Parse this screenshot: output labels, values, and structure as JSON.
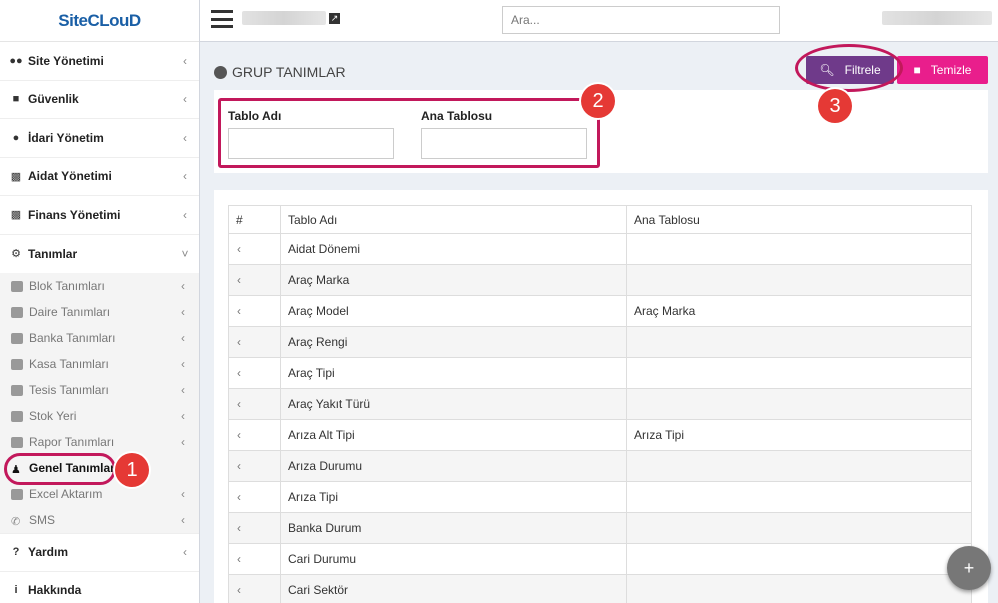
{
  "app": {
    "logo": "SiteCLouD"
  },
  "topbar": {
    "search_placeholder": "Ara..."
  },
  "sidebar": {
    "top_items": [
      {
        "label": "Site Yönetimi",
        "icon": "users-icon"
      },
      {
        "label": "Güvenlik",
        "icon": "lock-icon"
      },
      {
        "label": "İdari Yönetim",
        "icon": "globe-icon"
      },
      {
        "label": "Aidat Yönetimi",
        "icon": "money-icon"
      },
      {
        "label": "Finans Yönetimi",
        "icon": "money-icon"
      },
      {
        "label": "Tanımlar",
        "icon": "gear-icon"
      }
    ],
    "sub_items": [
      {
        "label": "Blok Tanımları",
        "icon": "building-icon"
      },
      {
        "label": "Daire Tanımları",
        "icon": "door-icon"
      },
      {
        "label": "Banka Tanımları",
        "icon": "card-icon"
      },
      {
        "label": "Kasa Tanımları",
        "icon": "money-icon"
      },
      {
        "label": "Tesis Tanımları",
        "icon": "box-icon"
      },
      {
        "label": "Stok Yeri",
        "icon": "archive-icon"
      },
      {
        "label": "Rapor Tanımları",
        "icon": "report-icon"
      },
      {
        "label": "Genel Tanımlar",
        "icon": "user-icon"
      },
      {
        "label": "Excel Aktarım",
        "icon": "file-icon"
      },
      {
        "label": "SMS",
        "icon": "phone-icon"
      }
    ],
    "bottom_items": [
      {
        "label": "Yardım",
        "icon": "question-icon"
      },
      {
        "label": "Hakkında",
        "icon": "info-icon"
      }
    ]
  },
  "page": {
    "title": "GRUP TANIMLAR",
    "filter_button": "Filtrele",
    "clear_button": "Temizle",
    "fields": {
      "tablo_adi_label": "Tablo Adı",
      "ana_tablosu_label": "Ana Tablosu"
    }
  },
  "table": {
    "headers": [
      "#",
      "Tablo Adı",
      "Ana Tablosu"
    ],
    "rows": [
      {
        "name": "Aidat Dönemi",
        "parent": ""
      },
      {
        "name": "Araç Marka",
        "parent": ""
      },
      {
        "name": "Araç Model",
        "parent": "Araç Marka"
      },
      {
        "name": "Araç Rengi",
        "parent": ""
      },
      {
        "name": "Araç Tipi",
        "parent": ""
      },
      {
        "name": "Araç Yakıt Türü",
        "parent": ""
      },
      {
        "name": "Arıza Alt Tipi",
        "parent": "Arıza Tipi"
      },
      {
        "name": "Arıza Durumu",
        "parent": ""
      },
      {
        "name": "Arıza Tipi",
        "parent": ""
      },
      {
        "name": "Banka Durum",
        "parent": ""
      },
      {
        "name": "Cari Durumu",
        "parent": ""
      },
      {
        "name": "Cari Sektör",
        "parent": ""
      }
    ]
  },
  "annotations": [
    "1",
    "2",
    "3"
  ],
  "fab": "+",
  "colors": {
    "accent_purple": "#6f3a8a",
    "accent_pink": "#e91e8c",
    "annotation_ring": "#c2185b",
    "annotation_badge": "#e53935"
  }
}
